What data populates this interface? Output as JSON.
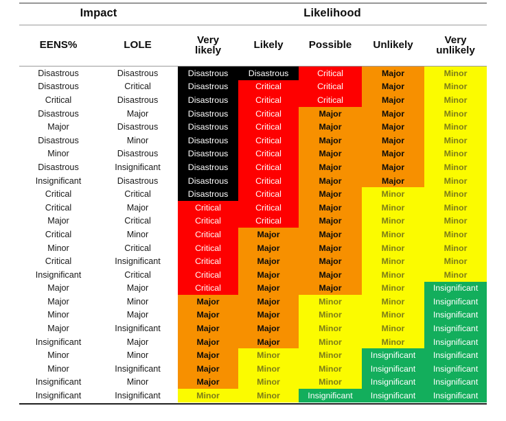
{
  "header": {
    "groups": [
      {
        "label": "Impact",
        "span": 2
      },
      {
        "label": "Likelihood",
        "span": 5
      }
    ],
    "columns": [
      "EENS%",
      "LOLE",
      "Very\nlikely",
      "Likely",
      "Possible",
      "Unlikely",
      "Very\nunlikely"
    ]
  },
  "legend_colors": {
    "disastrous": "#000000",
    "critical": "#fe0000",
    "major": "#f79000",
    "minor": "#fbfb00",
    "insignificant": "#13ae5c"
  },
  "chart_data": {
    "type": "heatmap",
    "title": "Risk matrix: Impact (EENS% / LOLE) versus Likelihood",
    "row_headers": [
      "EENS%",
      "LOLE"
    ],
    "column_headers": [
      "Very likely",
      "Likely",
      "Possible",
      "Unlikely",
      "Very unlikely"
    ],
    "levels": [
      "Disastrous",
      "Critical",
      "Major",
      "Minor",
      "Insignificant"
    ],
    "level_colors": [
      "#000000",
      "#fe0000",
      "#f79000",
      "#fbfb00",
      "#13ae5c"
    ],
    "rows": [
      {
        "eens": "Disastrous",
        "lole": "Disastrous",
        "cells": [
          "Disastrous",
          "Disastrous",
          "Critical",
          "Major",
          "Minor"
        ]
      },
      {
        "eens": "Disastrous",
        "lole": "Critical",
        "cells": [
          "Disastrous",
          "Critical",
          "Critical",
          "Major",
          "Minor"
        ]
      },
      {
        "eens": "Critical",
        "lole": "Disastrous",
        "cells": [
          "Disastrous",
          "Critical",
          "Critical",
          "Major",
          "Minor"
        ]
      },
      {
        "eens": "Disastrous",
        "lole": "Major",
        "cells": [
          "Disastrous",
          "Critical",
          "Major",
          "Major",
          "Minor"
        ]
      },
      {
        "eens": "Major",
        "lole": "Disastrous",
        "cells": [
          "Disastrous",
          "Critical",
          "Major",
          "Major",
          "Minor"
        ]
      },
      {
        "eens": "Disastrous",
        "lole": "Minor",
        "cells": [
          "Disastrous",
          "Critical",
          "Major",
          "Major",
          "Minor"
        ]
      },
      {
        "eens": "Minor",
        "lole": "Disastrous",
        "cells": [
          "Disastrous",
          "Critical",
          "Major",
          "Major",
          "Minor"
        ]
      },
      {
        "eens": "Disastrous",
        "lole": "Insignificant",
        "cells": [
          "Disastrous",
          "Critical",
          "Major",
          "Major",
          "Minor"
        ]
      },
      {
        "eens": "Insignificant",
        "lole": "Disastrous",
        "cells": [
          "Disastrous",
          "Critical",
          "Major",
          "Major",
          "Minor"
        ]
      },
      {
        "eens": "Critical",
        "lole": "Critical",
        "cells": [
          "Disastrous",
          "Critical",
          "Major",
          "Minor",
          "Minor"
        ]
      },
      {
        "eens": "Critical",
        "lole": "Major",
        "cells": [
          "Critical",
          "Critical",
          "Major",
          "Minor",
          "Minor"
        ]
      },
      {
        "eens": "Major",
        "lole": "Critical",
        "cells": [
          "Critical",
          "Critical",
          "Major",
          "Minor",
          "Minor"
        ]
      },
      {
        "eens": "Critical",
        "lole": "Minor",
        "cells": [
          "Critical",
          "Major",
          "Major",
          "Minor",
          "Minor"
        ]
      },
      {
        "eens": "Minor",
        "lole": "Critical",
        "cells": [
          "Critical",
          "Major",
          "Major",
          "Minor",
          "Minor"
        ]
      },
      {
        "eens": "Critical",
        "lole": "Insignificant",
        "cells": [
          "Critical",
          "Major",
          "Major",
          "Minor",
          "Minor"
        ]
      },
      {
        "eens": "Insignificant",
        "lole": "Critical",
        "cells": [
          "Critical",
          "Major",
          "Major",
          "Minor",
          "Minor"
        ]
      },
      {
        "eens": "Major",
        "lole": "Major",
        "cells": [
          "Critical",
          "Major",
          "Major",
          "Minor",
          "Insignificant"
        ]
      },
      {
        "eens": "Major",
        "lole": "Minor",
        "cells": [
          "Major",
          "Major",
          "Minor",
          "Minor",
          "Insignificant"
        ]
      },
      {
        "eens": "Minor",
        "lole": "Major",
        "cells": [
          "Major",
          "Major",
          "Minor",
          "Minor",
          "Insignificant"
        ]
      },
      {
        "eens": "Major",
        "lole": "Insignificant",
        "cells": [
          "Major",
          "Major",
          "Minor",
          "Minor",
          "Insignificant"
        ]
      },
      {
        "eens": "Insignificant",
        "lole": "Major",
        "cells": [
          "Major",
          "Major",
          "Minor",
          "Minor",
          "Insignificant"
        ]
      },
      {
        "eens": "Minor",
        "lole": "Minor",
        "cells": [
          "Major",
          "Minor",
          "Minor",
          "Insignificant",
          "Insignificant"
        ]
      },
      {
        "eens": "Minor",
        "lole": "Insignificant",
        "cells": [
          "Major",
          "Minor",
          "Minor",
          "Insignificant",
          "Insignificant"
        ]
      },
      {
        "eens": "Insignificant",
        "lole": "Minor",
        "cells": [
          "Major",
          "Minor",
          "Minor",
          "Insignificant",
          "Insignificant"
        ]
      },
      {
        "eens": "Insignificant",
        "lole": "Insignificant",
        "cells": [
          "Minor",
          "Minor",
          "Insignificant",
          "Insignificant",
          "Insignificant"
        ]
      }
    ]
  }
}
